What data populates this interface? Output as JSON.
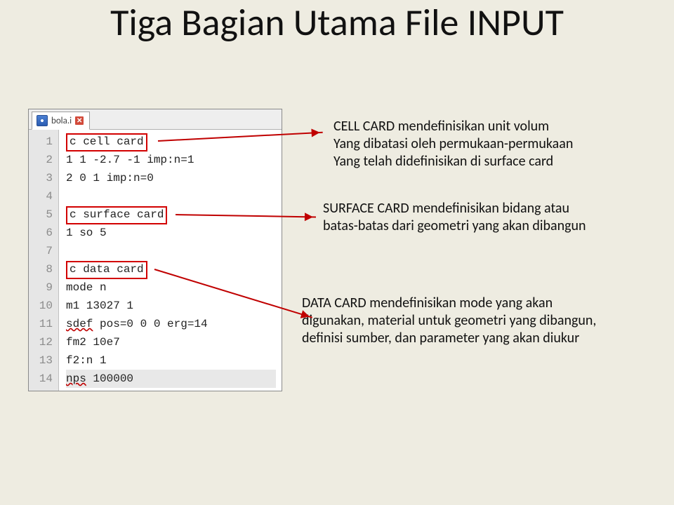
{
  "title": "Tiga Bagian Utama File INPUT",
  "editor": {
    "tab_filename": "bola.i",
    "tab_close_glyph": "✕",
    "lines": [
      {
        "n": "1",
        "text": "c cell card",
        "boxed": true
      },
      {
        "n": "2",
        "text": "1 1 -2.7 -1 imp:n=1"
      },
      {
        "n": "3",
        "text": "2 0 1 imp:n=0"
      },
      {
        "n": "4",
        "text": ""
      },
      {
        "n": "5",
        "text": "c surface card",
        "boxed": true
      },
      {
        "n": "6",
        "text": "1 so 5"
      },
      {
        "n": "7",
        "text": ""
      },
      {
        "n": "8",
        "text": "c data card",
        "boxed": true
      },
      {
        "n": "9",
        "text": "mode n"
      },
      {
        "n": "10",
        "text": "m1 13027 1"
      },
      {
        "n": "11",
        "text_pre": "sdef",
        "text_rest": " pos=0 0 0 erg=14",
        "squiggly_first": true
      },
      {
        "n": "12",
        "text": "fm2 10e7"
      },
      {
        "n": "13",
        "text": "f2:n 1"
      },
      {
        "n": "14",
        "text_pre": "nps",
        "text_rest": " 100000",
        "squiggly_first": true,
        "current": true
      }
    ]
  },
  "annotations": {
    "cell": "CELL CARD mendefinisikan unit volum\nYang dibatasi oleh permukaan-permukaan\nYang telah didefinisikan di surface card",
    "surface": "SURFACE CARD mendefinisikan bidang atau\nbatas-batas dari geometri yang akan dibangun",
    "data": "DATA CARD mendefinisikan mode yang akan\ndigunakan, material untuk geometri yang dibangun,\ndefinisi sumber, dan parameter yang akan diukur"
  }
}
